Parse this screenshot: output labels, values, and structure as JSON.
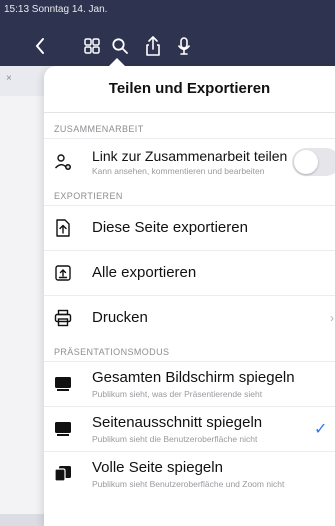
{
  "status_bar": {
    "time_date": "15:13  Sonntag 14. Jan."
  },
  "toolbar": {
    "icons": [
      "back-icon",
      "grid-icon",
      "search-icon",
      "share-icon",
      "microphone-icon"
    ]
  },
  "subbar": {
    "close_glyph": "×"
  },
  "popover": {
    "title": "Teilen und Exportieren",
    "sections": {
      "collab": {
        "header": "ZUSAMMENARBEIT",
        "link": {
          "label": "Link zur Zusammenarbeit teilen",
          "sub": "Kann ansehen, kommentieren und bearbeiten",
          "toggle_on": false
        }
      },
      "export": {
        "header": "EXPORTIEREN",
        "items": [
          {
            "label": "Diese Seite exportieren"
          },
          {
            "label": "Alle exportieren"
          },
          {
            "label": "Drucken",
            "chevron": "›"
          }
        ]
      },
      "present": {
        "header": "PRÄSENTATIONSMODUS",
        "items": [
          {
            "label": "Gesamten Bildschirm spiegeln",
            "sub": "Publikum sieht, was der Präsentierende sieht"
          },
          {
            "label": "Seitenausschnitt spiegeln",
            "sub": "Publikum sieht die Benutzeroberfläche nicht",
            "check": "✓"
          },
          {
            "label": "Volle Seite spiegeln",
            "sub": "Publikum sieht Benutzeroberfläche und Zoom nicht"
          }
        ]
      }
    }
  },
  "colors": {
    "toolbar_bg": "#2e3350",
    "accent": "#2f7cf6"
  }
}
